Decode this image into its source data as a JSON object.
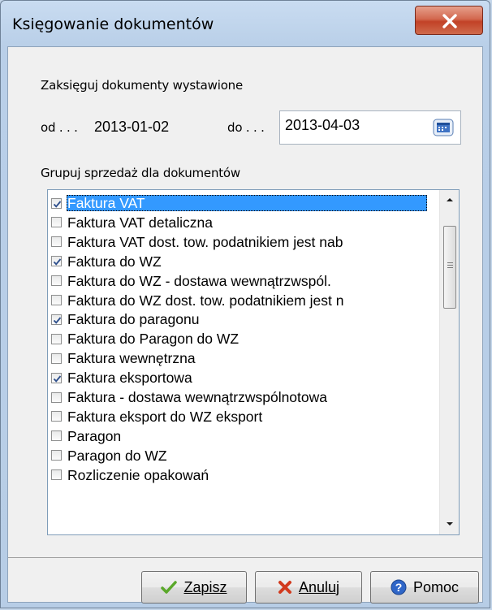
{
  "window": {
    "title": "Księgowanie dokumentów"
  },
  "range": {
    "heading": "Zaksięguj dokumenty wystawione",
    "from_label": "od . . .",
    "from_value": "2013-01-02",
    "to_label": "do . . .",
    "to_value": "2013-04-03"
  },
  "group": {
    "heading": "Grupuj sprzedaż dla dokumentów"
  },
  "documents": [
    {
      "label": "Faktura VAT",
      "checked": true,
      "selected": true
    },
    {
      "label": "Faktura VAT detaliczna",
      "checked": false
    },
    {
      "label": "Faktura VAT dost. tow. podatnikiem jest nab",
      "checked": false
    },
    {
      "label": "Faktura do WZ",
      "checked": true
    },
    {
      "label": "Faktura do WZ - dostawa wewnątrzwspól.",
      "checked": false
    },
    {
      "label": "Faktura do WZ dost. tow. podatnikiem jest n",
      "checked": false
    },
    {
      "label": "Faktura do paragonu",
      "checked": true
    },
    {
      "label": "Faktura do Paragon do WZ",
      "checked": false
    },
    {
      "label": "Faktura wewnętrzna",
      "checked": false
    },
    {
      "label": "Faktura eksportowa",
      "checked": true
    },
    {
      "label": "Faktura - dostawa wewnątrzwspólnotowa",
      "checked": false
    },
    {
      "label": "Faktura eksport do WZ eksport",
      "checked": false
    },
    {
      "label": "Paragon",
      "checked": false
    },
    {
      "label": "Paragon do WZ",
      "checked": false
    },
    {
      "label": "Rozliczenie opakowań",
      "checked": false
    }
  ],
  "buttons": {
    "save": "Zapisz",
    "cancel": "Anuluj",
    "help": "Pomoc"
  },
  "icons": {
    "close": "close-icon",
    "calendar": "calendar-icon",
    "save": "checkmark-icon",
    "cancel": "x-icon",
    "help": "question-icon"
  },
  "colors": {
    "selection": "#3399ff",
    "close_button": "#c94a2e",
    "check": "#2e4f8c"
  }
}
